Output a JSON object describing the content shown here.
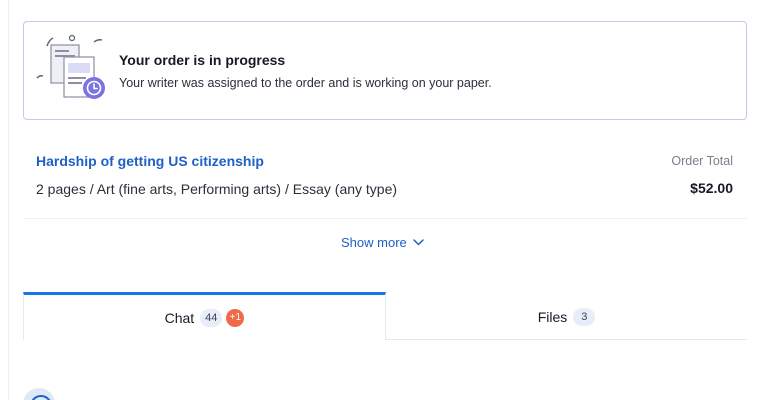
{
  "status": {
    "title": "Your order is in progress",
    "description": "Your writer was assigned to the order and is working on your paper."
  },
  "order": {
    "title": "Hardship of getting US citizenship",
    "details": "2 pages / Art (fine arts, Performing arts) / Essay (any type)",
    "total_label": "Order Total",
    "total_value": "$52.00"
  },
  "show_more": {
    "label": "Show more",
    "icon": "chevron-down-icon"
  },
  "tabs": [
    {
      "label": "Chat",
      "count": "44",
      "badge": "+1",
      "active": true
    },
    {
      "label": "Files",
      "count": "3",
      "active": false
    }
  ],
  "colors": {
    "accent": "#1a73e8",
    "link": "#1f5fc8",
    "card_border": "#c9c6ee",
    "badge": "#f06a4a",
    "illustration": "#7b74e0"
  }
}
